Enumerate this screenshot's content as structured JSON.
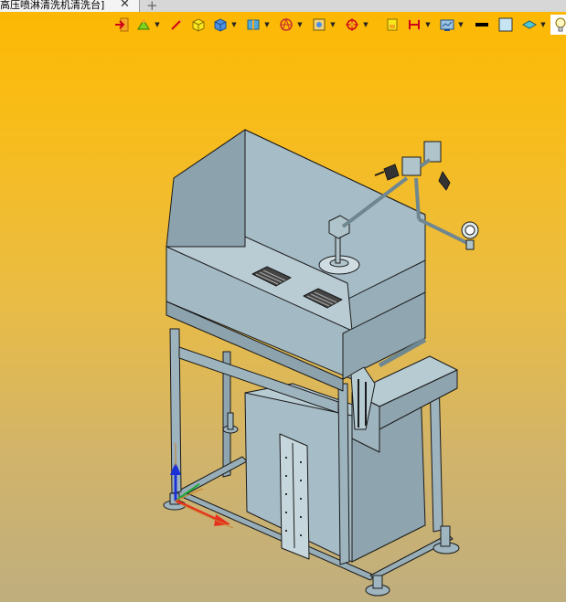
{
  "tab": {
    "title": "高压喷淋清洗机清洗台]",
    "close_glyph": "✕",
    "new_tab_glyph": "+"
  },
  "toolbar": {
    "dropdown_glyph": "▼",
    "icons": [
      "exit-sketch-icon",
      "sketch-tools-icon",
      "smart-dimension-icon",
      "feature-box-icon",
      "solid-shape-icon",
      "surface-shape-icon",
      "section-view-icon",
      "target-point-icon",
      "view-frame-icon",
      "dimension-icon",
      "rendering-icon",
      "line-color-icon",
      "fill-color-icon",
      "layers-icon",
      "light-icon"
    ]
  },
  "colors": {
    "background_top": "#fdb800",
    "background_bottom": "#bfae7e",
    "model_body": "#9fb5bf",
    "model_edge": "#1a1a1a",
    "axis_x": "#e83020",
    "axis_y": "#21a838",
    "axis_z": "#1a30d8"
  }
}
